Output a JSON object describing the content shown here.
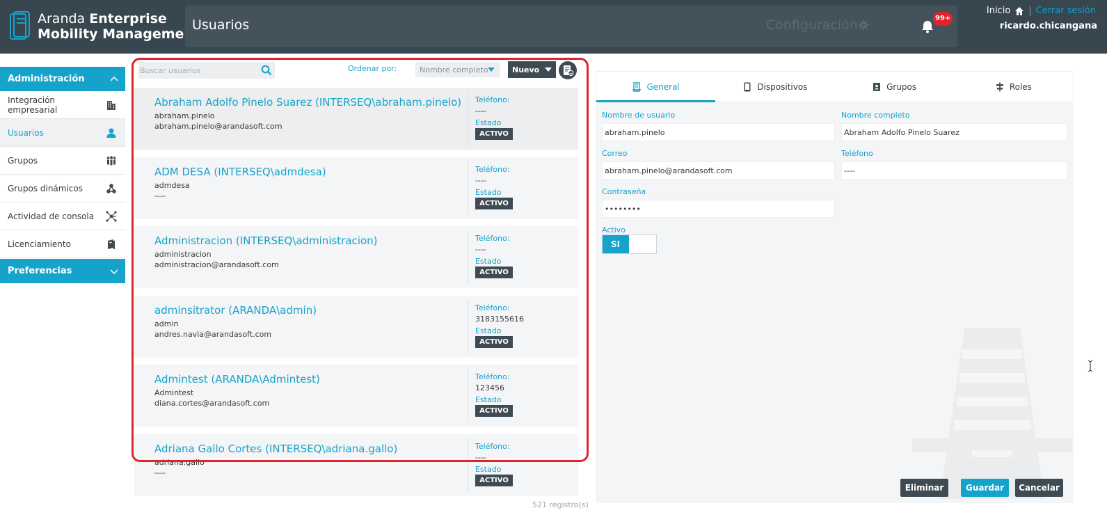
{
  "header": {
    "brand_line1_light": "Aranda ",
    "brand_line1_bold": "Enterprise",
    "brand_line2": "Mobility Management",
    "page_title": "Usuarios",
    "config_label": "Configuración",
    "notifications_count": "99+",
    "home_label": "Inicio",
    "separator": "|",
    "logout_label": "Cerrar sesión",
    "username": "ricardo.chicangana"
  },
  "sidebar": {
    "admin_header": "Administración",
    "items": [
      {
        "label": "Integración empresarial",
        "icon": "building-icon",
        "active": false
      },
      {
        "label": "Usuarios",
        "icon": "user-icon",
        "active": true
      },
      {
        "label": "Grupos",
        "icon": "group-icon",
        "active": false
      },
      {
        "label": "Grupos dinámicos",
        "icon": "dynamic-groups-icon",
        "active": false
      },
      {
        "label": "Actividad de consola",
        "icon": "network-icon",
        "active": false
      },
      {
        "label": "Licenciamiento",
        "icon": "book-icon",
        "active": false
      }
    ],
    "prefs_header": "Preferencias"
  },
  "list": {
    "search_placeholder": "Buscar usuarios",
    "order_label": "Ordenar por:",
    "order_value": "Nombre completo",
    "new_label": "Nuevo",
    "phone_label": "Teléfono:",
    "state_label": "Estado",
    "records": "521 registro(s)",
    "users": [
      {
        "name": "Abraham Adolfo Pinelo Suarez (INTERSEQ\\abraham.pinelo)",
        "login": "abraham.pinelo",
        "email": "abraham.pinelo@arandasoft.com",
        "phone": "----",
        "status": "ACTIVO"
      },
      {
        "name": "ADM DESA (INTERSEQ\\admdesa)",
        "login": "admdesa",
        "email": "----",
        "phone": "----",
        "status": "ACTIVO"
      },
      {
        "name": "Administracion (INTERSEQ\\administracion)",
        "login": "administracion",
        "email": "administracion@arandasoft.com",
        "phone": "----",
        "status": "ACTIVO"
      },
      {
        "name": "adminsitrator (ARANDA\\admin)",
        "login": "admin",
        "email": "andres.navia@arandasoft.com",
        "phone": "3183155616",
        "status": "ACTIVO"
      },
      {
        "name": "Admintest (ARANDA\\Admintest)",
        "login": "Admintest",
        "email": "diana.cortes@arandasoft.com",
        "phone": "123456",
        "status": "ACTIVO"
      },
      {
        "name": "Adriana Gallo Cortes (INTERSEQ\\adriana.gallo)",
        "login": "adriana.gallo",
        "email": "----",
        "phone": "----",
        "status": "ACTIVO"
      }
    ]
  },
  "detail": {
    "tabs": [
      "General",
      "Dispositivos",
      "Grupos",
      "Roles"
    ],
    "username_label": "Nombre de usuario",
    "username_value": "abraham.pinelo",
    "fullname_label": "Nombre completo",
    "fullname_value": "Abraham Adolfo Pinelo Suarez",
    "email_label": "Correo",
    "email_value": "abraham.pinelo@arandasoft.com",
    "phone_label": "Teléfono",
    "phone_value": "----",
    "password_label": "Contraseña",
    "password_value": "••••••••",
    "active_label": "Activo",
    "active_toggle": "SI",
    "delete_label": "Eliminar",
    "save_label": "Guardar",
    "cancel_label": "Cancelar"
  },
  "colors": {
    "accent": "#15a3cc",
    "header_bg": "#37464f",
    "dark_button": "#3e4b53",
    "highlight": "#e3232b"
  }
}
